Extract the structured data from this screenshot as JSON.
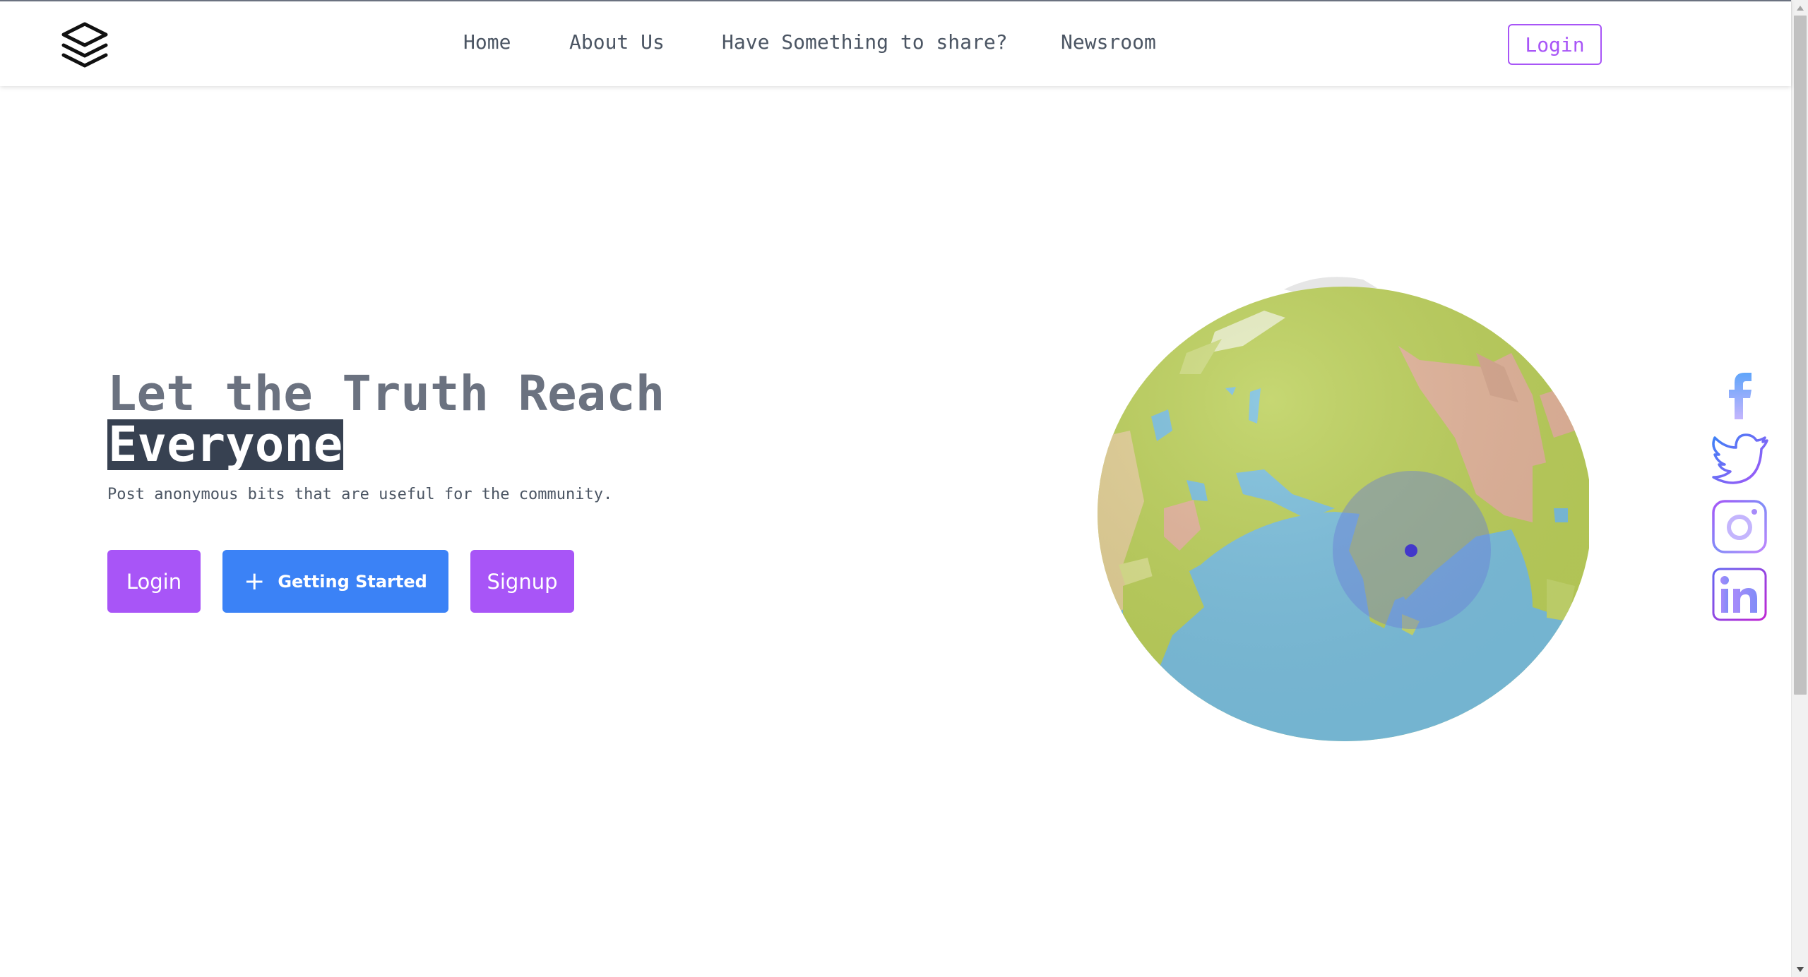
{
  "nav": {
    "links": [
      "Home",
      "About Us",
      "Have Something to share?",
      "Newsroom"
    ],
    "login_label": "Login"
  },
  "hero": {
    "title_line1": "Let the Truth Reach",
    "title_line2": "Everyone",
    "subtitle": "Post anonymous bits that are useful for the community.",
    "buttons": {
      "login": "Login",
      "getting_started_icon": "+",
      "getting_started": "Getting Started",
      "signup": "Signup"
    }
  },
  "globe": {
    "icon": "globe-3d",
    "marker_color": "#4338ca"
  },
  "social": {
    "icons": [
      "facebook-icon",
      "twitter-icon",
      "instagram-icon",
      "linkedin-icon"
    ]
  },
  "colors": {
    "primary_purple": "#a855f7",
    "primary_blue": "#3b82f6",
    "title_gray": "#6b7280",
    "highlight_bg": "#374151",
    "ocean": "#7bbfdd",
    "land": "#bcd05a",
    "desert": "#e3b49a"
  }
}
